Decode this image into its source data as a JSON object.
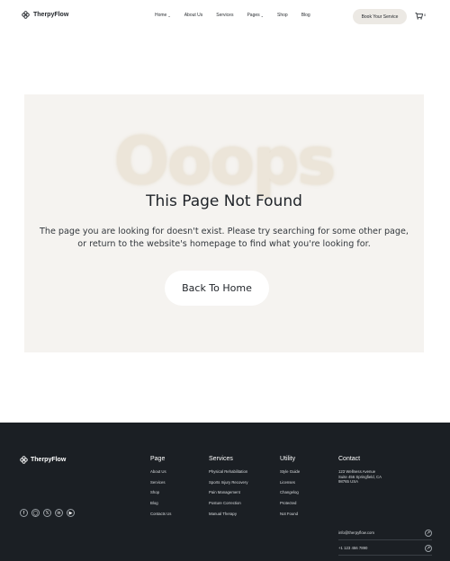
{
  "brand": {
    "name": "TherpyFlow"
  },
  "nav": {
    "items": [
      {
        "label": "Home",
        "dropdown": true
      },
      {
        "label": "About Us",
        "dropdown": false
      },
      {
        "label": "Services",
        "dropdown": false
      },
      {
        "label": "Pages",
        "dropdown": true
      },
      {
        "label": "Shop",
        "dropdown": false
      },
      {
        "label": "Blog",
        "dropdown": false
      }
    ],
    "cta_label": "Book Your Service",
    "cart_count": "0"
  },
  "notfound": {
    "watermark": "Ooops",
    "title": "This Page Not Found",
    "description": "The page you are looking for doesn't exist. Please try searching for some other page, or return to the website's homepage to find what you're looking for.",
    "button_label": "Back To Home"
  },
  "footer": {
    "brand": "TherpyFlow",
    "socials": [
      "facebook-icon",
      "instagram-icon",
      "x-icon",
      "linkedin-icon",
      "youtube-icon"
    ],
    "columns": {
      "page": {
        "title": "Page",
        "links": [
          "About Us",
          "Services",
          "Shop",
          "Blog",
          "Contacts Us"
        ]
      },
      "services": {
        "title": "Services",
        "links": [
          "Physical Rehabilitation",
          "Sports Injury Recovery",
          "Pain Management",
          "Posture Correction",
          "Manual Therapy"
        ]
      },
      "utility": {
        "title": "Utility",
        "links": [
          "Style Guide",
          "Licenses",
          "Changelog",
          "Protected",
          "Not Found"
        ]
      }
    },
    "contact": {
      "title": "Contact",
      "address_lines": [
        "123 Wellness Avenue",
        "Suite 456 Springfield, CA",
        "98765 USA"
      ],
      "email": "info@therpyflow.com",
      "phone": "+1 123 456 7890"
    }
  },
  "colors": {
    "footer_bg": "#1b1f24",
    "panel_bg": "#f5f3f0",
    "cta_bg": "#ece9e4"
  }
}
